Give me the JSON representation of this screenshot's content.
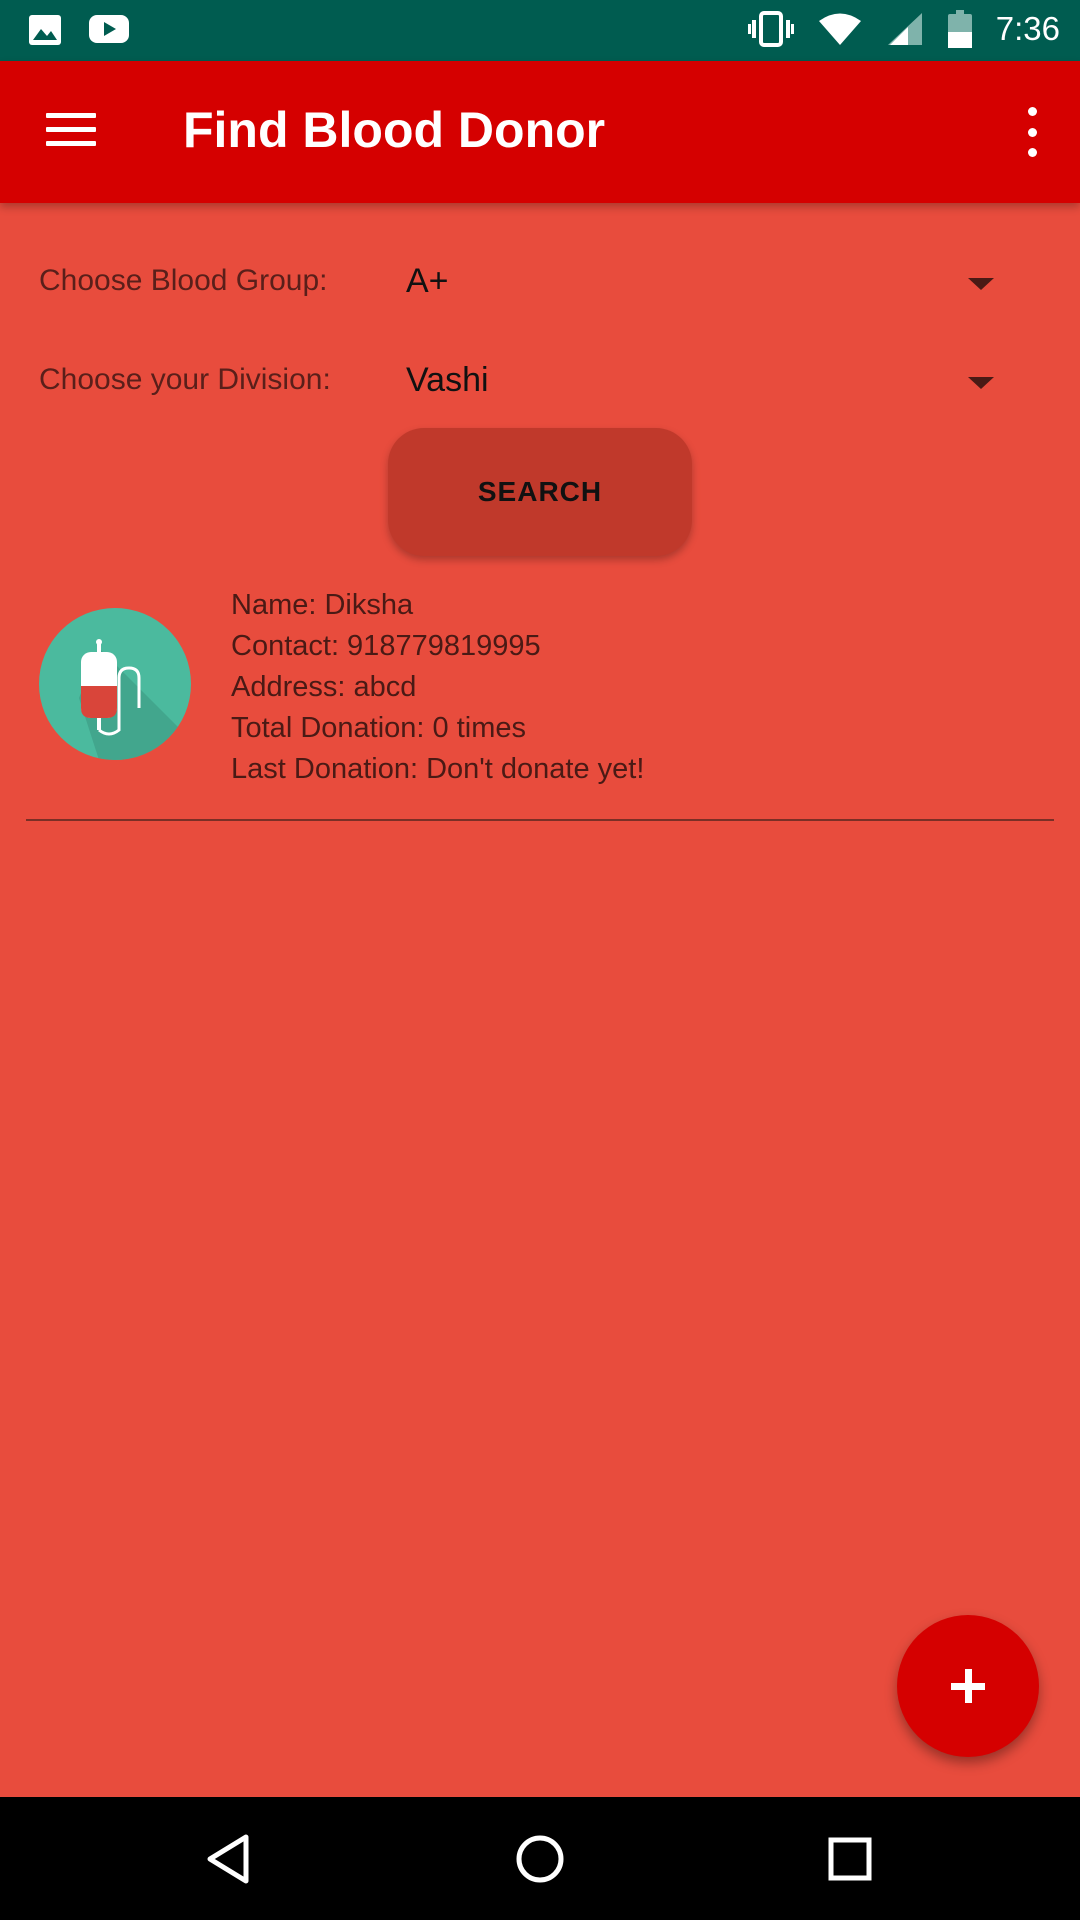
{
  "status_bar": {
    "time": "7:36",
    "left_icons": [
      "image-icon",
      "youtube-icon"
    ],
    "right_icons": [
      "vibrate-icon",
      "wifi-icon",
      "signal-icon",
      "battery-icon"
    ],
    "color": "#005C50"
  },
  "app_bar": {
    "title": "Find Blood Donor",
    "menu_icon": "menu-icon",
    "overflow_icon": "more-vert-icon",
    "color": "#D50000"
  },
  "form": {
    "blood_group_label": "Choose Blood Group:",
    "blood_group_value": "A+",
    "division_label": "Choose your Division:",
    "division_value": "Vashi",
    "search_label": "SEARCH"
  },
  "donors": [
    {
      "icon": "blood-bag-icon",
      "name": "Name: Diksha",
      "contact": "Contact: 918779819995",
      "address": "Address: abcd",
      "total_donation": "Total Donation: 0 times",
      "last_donation": "Last Donation: Don't donate yet!"
    }
  ],
  "fab": {
    "icon": "add-icon",
    "color": "#D50000"
  },
  "nav_bar": {
    "buttons": [
      "back-icon",
      "home-icon",
      "recents-icon"
    ]
  },
  "colors": {
    "background": "#E84C3D",
    "button": "#C0392B",
    "avatar": "#4BBA9E"
  }
}
